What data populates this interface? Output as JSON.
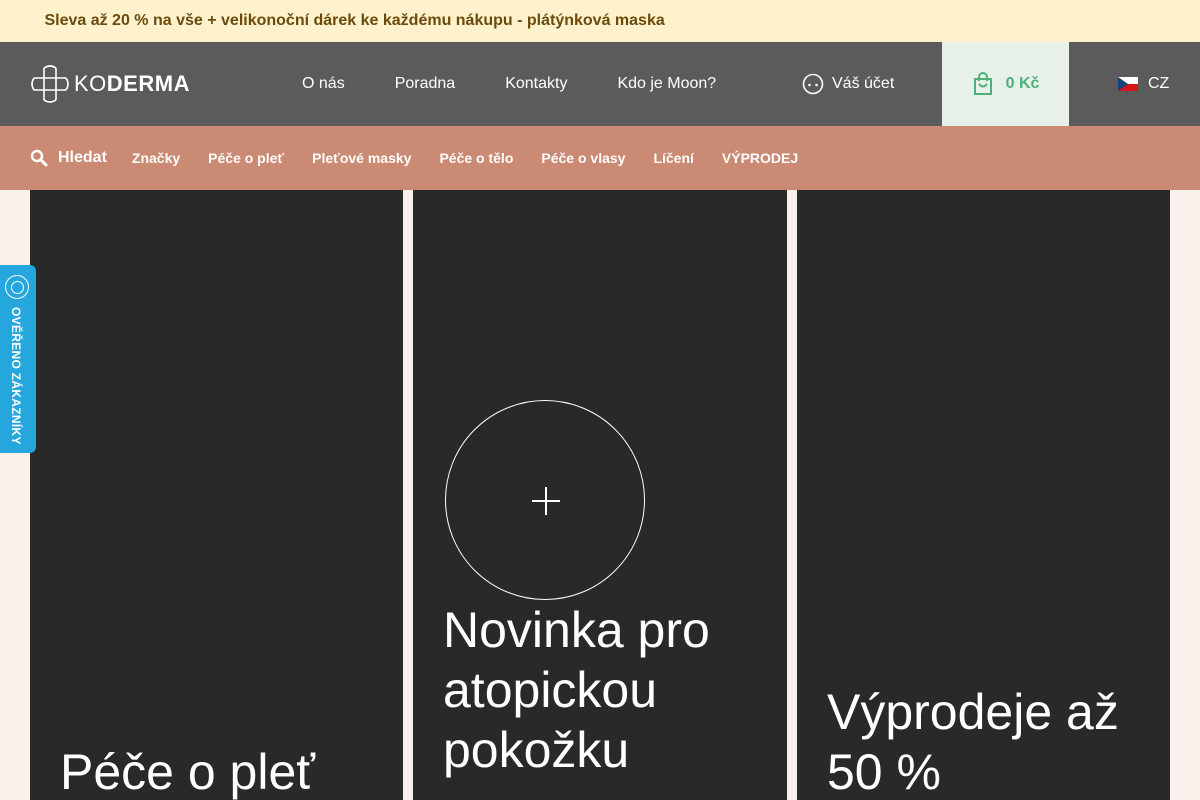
{
  "promo": {
    "text": "Sleva až 20 % na vše + velikonoční dárek ke každému nákupu - plátýnková maska",
    "glyph_left": "",
    "glyph_right": ""
  },
  "header": {
    "logo_light": "KO",
    "logo_bold": "DERMA",
    "nav": [
      "O nás",
      "Poradna",
      "Kontakty",
      "Kdo je Moon?"
    ],
    "account_label": "Váš účet",
    "cart_total": "0 Kč",
    "language": "CZ"
  },
  "categories": {
    "search_label": "Hledat",
    "items": [
      "Značky",
      "Péče o pleť",
      "Pleťové masky",
      "Péče o tělo",
      "Péče o vlasy",
      "Líčení",
      "VÝPRODEJ"
    ]
  },
  "cards": [
    {
      "title": "Péče o pleť"
    },
    {
      "title": "Novinka pro atopickou pokožku"
    },
    {
      "title": "Výprodeje až 50 %"
    }
  ],
  "verified": {
    "label": "OVĚŘENO ZÁKAZNÍKY"
  },
  "colors": {
    "promo_bg": "#fef2cd",
    "topbar_bg": "#5b5b5b",
    "catbar_bg": "#cb8a73",
    "cart_accent": "#4fb179",
    "verified_bg": "#25a6dc",
    "card_bg": "#292929"
  },
  "icons": {
    "account": "account-icon",
    "cart": "shopping-bag-icon",
    "search": "search-icon",
    "flag": "czech-flag-icon",
    "plus": "plus-icon"
  }
}
